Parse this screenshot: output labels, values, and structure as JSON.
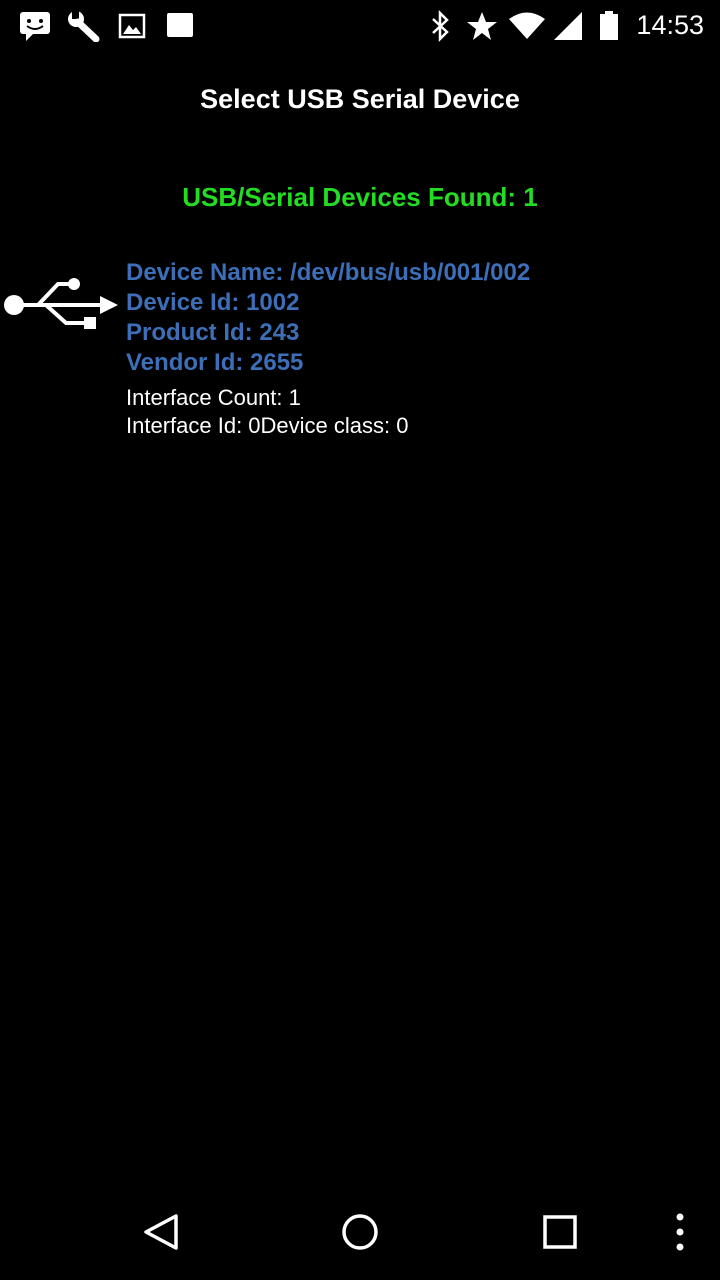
{
  "status_bar": {
    "time": "14:53",
    "left_icons": [
      "message-icon",
      "wrench-icon",
      "image-icon",
      "square-icon"
    ],
    "right_icons": [
      "bluetooth-icon",
      "star-icon",
      "wifi-icon",
      "signal-icon",
      "battery-icon"
    ]
  },
  "header": {
    "title": "Select USB Serial Device"
  },
  "summary": {
    "found_text": "USB/Serial Devices Found: 1"
  },
  "device": {
    "icon": "usb-icon",
    "name_line": "Device Name: /dev/bus/usb/001/002",
    "id_line": "Device Id: 1002",
    "product_line": "Product Id: 243",
    "vendor_line": "Vendor Id: 2655",
    "interface_count_line": "Interface Count: 1",
    "interface_id_line": "Interface Id: 0Device class: 0"
  },
  "nav_bar": {
    "buttons": [
      "back-icon",
      "home-icon",
      "recents-icon",
      "overflow-menu-icon"
    ]
  },
  "colors": {
    "background": "#000000",
    "title": "#ffffff",
    "found_green": "#22dd22",
    "device_blue": "#3d6fb8",
    "detail_white": "#ffffff"
  }
}
